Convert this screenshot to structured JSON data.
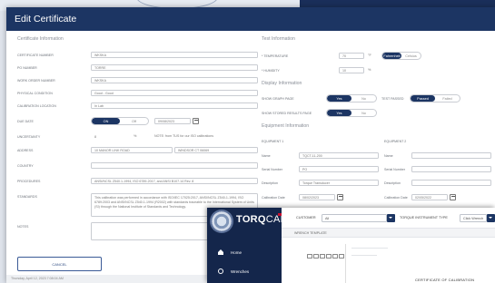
{
  "modal": {
    "title": "Edit Certificate",
    "cert_info_heading": "Certificate Information",
    "test_info_heading": "Test Information",
    "display_info_heading": "Display Information",
    "equip_info_heading": "Equipment Information",
    "fields": {
      "cert_number_label": "CERTIFICATE NUMBER",
      "cert_number": "WKSKA",
      "po_number_label": "PO NUMBER",
      "po_number": "TORRE",
      "work_order_label": "WORK ORDER NUMBER",
      "work_order": "WKSKA",
      "physical_condition_label": "PHYSICAL CONDITION",
      "physical_condition": "Good - Good",
      "cal_location_label": "CALIBRATION LOCATION",
      "cal_location": "In Lab",
      "due_date_label": "DUE DATE",
      "due_on": "ON",
      "due_off": "Off",
      "due_date": "09/08/2023",
      "uncertainty_label": "UNCERTAINTY",
      "uncertainty": "8",
      "uncertainty_unit": "%",
      "uncertainty_note": "NOTE: from TUS for our ISO calibrations",
      "address_label": "ADDRESS",
      "address_1": "10 MANOR LINK ROAD",
      "address_2": "WINDSOR CT 06069",
      "country_label": "COUNTRY",
      "country": "",
      "procedures_label": "PROCEDURES",
      "procedures": "ANSI/NCSL Z540.1-1994, ISO 6789-2017, and ANSI B107.14 Rev. 8",
      "standards_label": "STANDARDS",
      "standards": "This calibration was performed in accordance with ISO/IEC 17025:2017, ANSI/NCSL Z540-1-1994, ISO 6789:2003 and ANSI/NCSL Z540.1-1994 (R2002) with standards traceable to the International System of Units (SI) through the National Institute of Standards and Technology.",
      "notes_label": "NOTES",
      "notes": "",
      "temperature_label": "* TEMPERATURE",
      "temperature": "70",
      "temperature_unit": "°F",
      "temp_c": "Fahrenheit",
      "temp_f": "Celsius",
      "humidity_label": "* HUMIDITY",
      "humidity": "10",
      "humidity_unit": "%",
      "show_graph_label": "SHOW GRAPH PAGE",
      "yes": "Yes",
      "no": "No",
      "test_passed_label": "TEST PASSED",
      "passed": "Passed",
      "failed": "Failed",
      "show_stored_label": "SHOW STORED RESULTS PAGE",
      "equip1_label": "EQUIPMENT 1",
      "equip2_label": "EQUIPMENT 2",
      "name_label": "Name",
      "equip1_name": "TQCT-11-200",
      "serial_label": "Serial Number",
      "equip1_serial": "PO",
      "desc_label": "Description",
      "equip1_desc": "Torque Transducer",
      "caldate_label": "Calibration Date",
      "equip1_caldate": "08/02/2023",
      "equip2_caldate": "02/05/2022"
    },
    "cancel_label": "CANCEL",
    "footer_text": "Thursday, April 12, 2023 7:08:04 AM"
  },
  "torqcal": {
    "brand": "TORQ",
    "brand_suffix": "CAL",
    "customer_label": "CUSTOMER",
    "customer_value": "All",
    "instrument_label": "TORQUE INSTRUMENT TYPE",
    "instrument_value": "Click Wrench",
    "template_tab": "WRENCH TEMPLATE",
    "nav": [
      {
        "label": "Home",
        "icon": "home-icon"
      },
      {
        "label": "Wrenches",
        "icon": "gear-icon"
      }
    ],
    "doc_title": "CERTIFICATE OF CALIBRATION"
  }
}
